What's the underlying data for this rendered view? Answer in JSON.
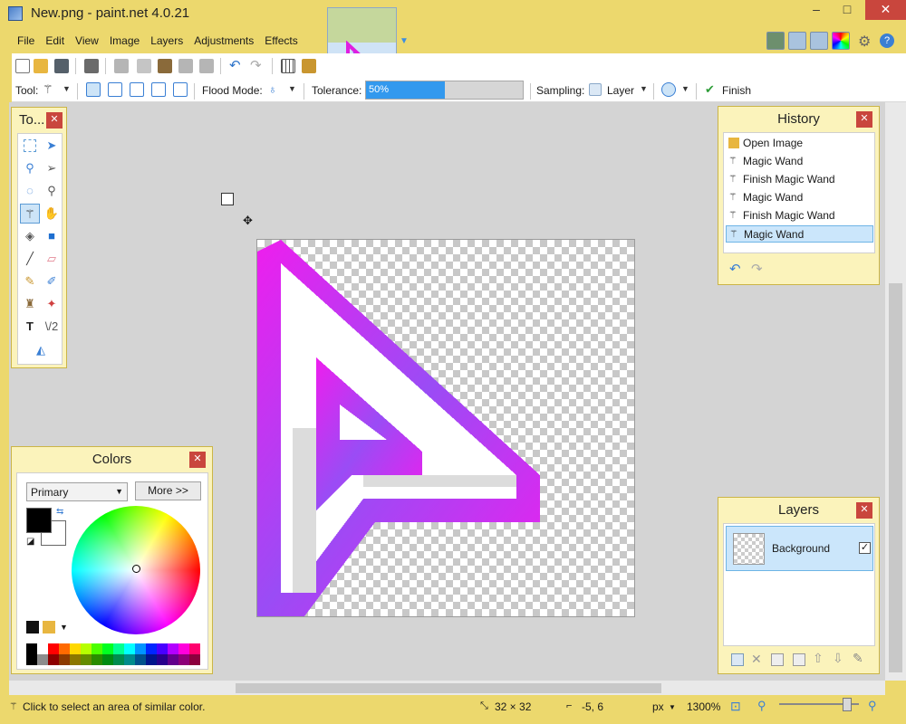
{
  "window": {
    "title": "New.png - paint.net 4.0.21"
  },
  "menu": [
    "File",
    "Edit",
    "View",
    "Image",
    "Layers",
    "Adjustments",
    "Effects"
  ],
  "toolbar2": {
    "tool_label": "Tool:",
    "flood_mode_label": "Flood Mode:",
    "tolerance_label": "Tolerance:",
    "tolerance_value": "50%",
    "tolerance_fraction": 0.5,
    "sampling_label": "Sampling:",
    "sampling_value": "Layer",
    "finish_label": "Finish"
  },
  "tools_panel": {
    "title": "To...",
    "selected_tool": "magic-wand-icon"
  },
  "history_panel": {
    "title": "History",
    "items": [
      "Open Image",
      "Magic Wand",
      "Finish Magic Wand",
      "Magic Wand",
      "Finish Magic Wand",
      "Magic Wand"
    ],
    "selected_index": 5
  },
  "colors_panel": {
    "title": "Colors",
    "mode": "Primary",
    "more_label": "More >>",
    "primary_color": "#000000",
    "secondary_color": "#ffffff",
    "palette": [
      "#000000",
      "#ffffff",
      "#ff0000",
      "#ff6a00",
      "#ffd800",
      "#b6ff00",
      "#4cff00",
      "#00ff21",
      "#00ff90",
      "#00ffff",
      "#0094ff",
      "#0026ff",
      "#4800ff",
      "#b200ff",
      "#ff00dc",
      "#ff006e"
    ]
  },
  "layers_panel": {
    "title": "Layers",
    "layers": [
      {
        "name": "Background",
        "visible": true
      }
    ]
  },
  "status": {
    "hint": "Click to select an area of similar color.",
    "image_size": "32 × 32",
    "cursor_pos": "-5, 6",
    "units": "px",
    "zoom": "1300%"
  }
}
